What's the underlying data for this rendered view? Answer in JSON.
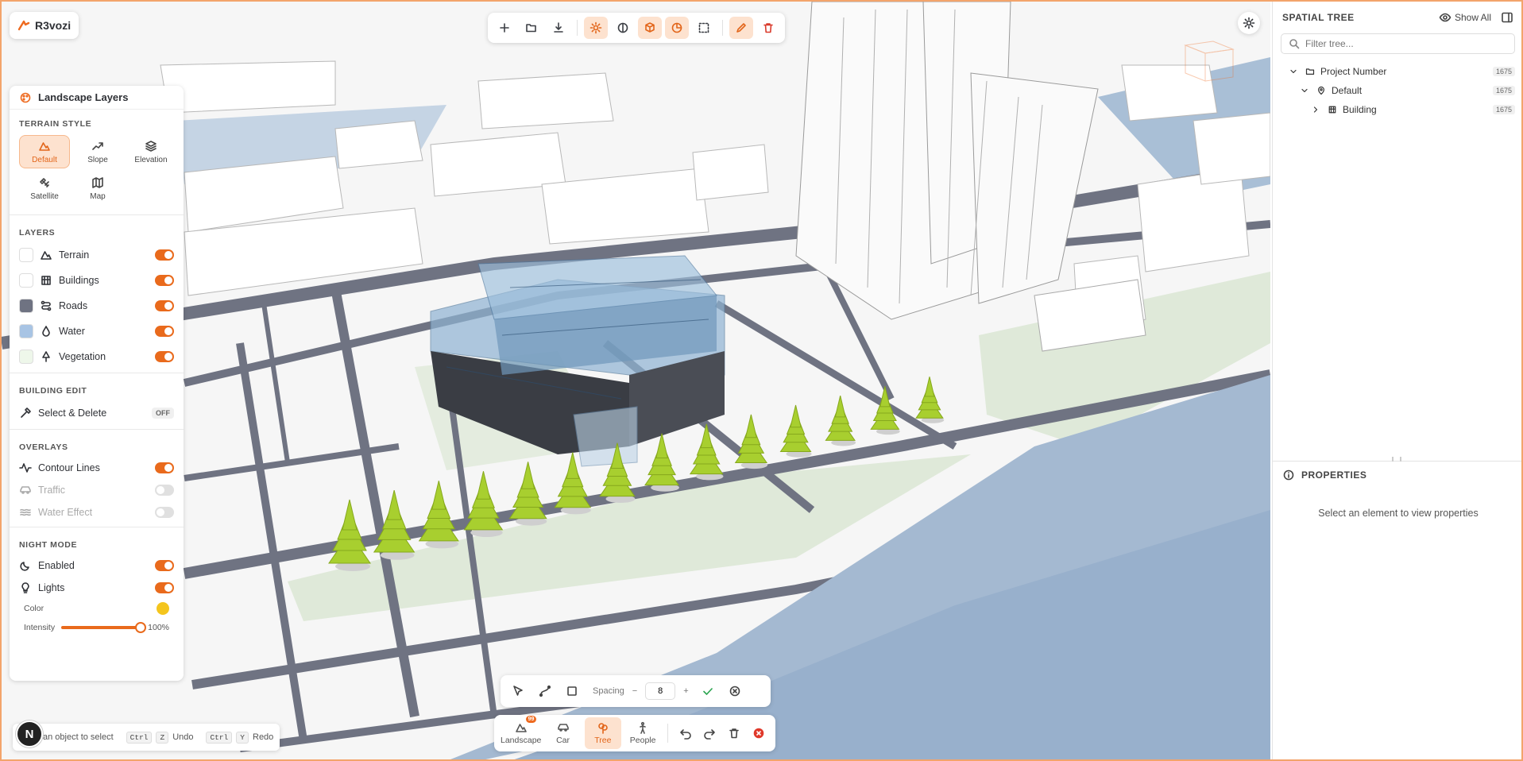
{
  "app": {
    "logo": "R3vozi"
  },
  "toolbar": {
    "buttons": [
      {
        "icon": "plus-icon",
        "state": "normal"
      },
      {
        "icon": "folder-open-icon",
        "state": "normal"
      },
      {
        "icon": "download-icon",
        "state": "normal"
      },
      {
        "icon": "sun-icon",
        "state": "active"
      },
      {
        "icon": "contrast-icon",
        "state": "normal"
      },
      {
        "icon": "cube-icon",
        "state": "active"
      },
      {
        "icon": "pie-icon",
        "state": "active"
      },
      {
        "icon": "dashed-box-icon",
        "state": "normal"
      },
      {
        "icon": "pencil-icon",
        "state": "active"
      },
      {
        "icon": "trash-icon",
        "state": "danger"
      }
    ]
  },
  "left_panel": {
    "title": "Landscape Layers",
    "terrain_style": {
      "title": "TERRAIN STYLE",
      "options": [
        {
          "label": "Default",
          "icon": "mountain-icon",
          "selected": true
        },
        {
          "label": "Slope",
          "icon": "trend-icon",
          "selected": false
        },
        {
          "label": "Elevation",
          "icon": "layers-icon",
          "selected": false
        },
        {
          "label": "Satellite",
          "icon": "satellite-icon",
          "selected": false
        },
        {
          "label": "Map",
          "icon": "map-icon",
          "selected": false
        }
      ]
    },
    "layers": {
      "title": "LAYERS",
      "items": [
        {
          "label": "Terrain",
          "icon": "mountain-icon",
          "color": "#ffffff",
          "on": true
        },
        {
          "label": "Buildings",
          "icon": "building-icon",
          "color": "#ffffff",
          "on": true
        },
        {
          "label": "Roads",
          "icon": "route-icon",
          "color": "#6f7382",
          "on": true
        },
        {
          "label": "Water",
          "icon": "water-icon",
          "color": "#a8c4e4",
          "on": true
        },
        {
          "label": "Vegetation",
          "icon": "tree-icon",
          "color": "#eef7ea",
          "on": true
        }
      ]
    },
    "building_edit": {
      "title": "BUILDING EDIT",
      "label": "Select & Delete",
      "state": "OFF"
    },
    "overlays": {
      "title": "OVERLAYS",
      "items": [
        {
          "label": "Contour Lines",
          "icon": "pulse-icon",
          "on": true,
          "enabled": true
        },
        {
          "label": "Traffic",
          "icon": "car-icon",
          "on": false,
          "enabled": false
        },
        {
          "label": "Water Effect",
          "icon": "waves-icon",
          "on": false,
          "enabled": false
        }
      ]
    },
    "night_mode": {
      "title": "NIGHT MODE",
      "enabled_label": "Enabled",
      "lights_label": "Lights",
      "enabled_on": true,
      "lights_on": true,
      "color_label": "Color",
      "color_value": "#f4c51d",
      "intensity_label": "Intensity",
      "intensity_value": "100%",
      "intensity_fraction": 1.0
    }
  },
  "draw_bar": {
    "spacing_label": "Spacing",
    "minus": "−",
    "plus": "+",
    "spacing_value": "8"
  },
  "bottom_bar": {
    "items": [
      {
        "label": "Landscape",
        "icon": "mountain-icon",
        "selected": false,
        "badge": "99"
      },
      {
        "label": "Car",
        "icon": "car-icon",
        "selected": false
      },
      {
        "label": "Tree",
        "icon": "tree-icon",
        "selected": true
      },
      {
        "label": "People",
        "icon": "person-icon",
        "selected": false
      }
    ]
  },
  "hint": {
    "text": "an object to select",
    "undo_keys": [
      "Ctrl",
      "Z"
    ],
    "undo_label": "Undo",
    "redo_keys": [
      "Ctrl",
      "Y"
    ],
    "redo_label": "Redo",
    "avatar_letter": "N"
  },
  "sidebar": {
    "title": "SPATIAL TREE",
    "show_all": "Show All",
    "filter_placeholder": "Filter tree...",
    "tree": [
      {
        "label": "Project Number",
        "count": "1675",
        "level": 0,
        "icon": "folder-icon",
        "expanded": true
      },
      {
        "label": "Default",
        "count": "1675",
        "level": 1,
        "icon": "pin-icon",
        "expanded": true
      },
      {
        "label": "Building",
        "count": "1675",
        "level": 2,
        "icon": "building-icon",
        "expanded": false
      }
    ],
    "properties_title": "PROPERTIES",
    "properties_empty": "Select an element to view properties"
  },
  "scene": {
    "sky": "#f2f2f2",
    "water": "#98b0cc",
    "road": "#6f7382",
    "green": "#dfe9d9",
    "trees": 14
  }
}
